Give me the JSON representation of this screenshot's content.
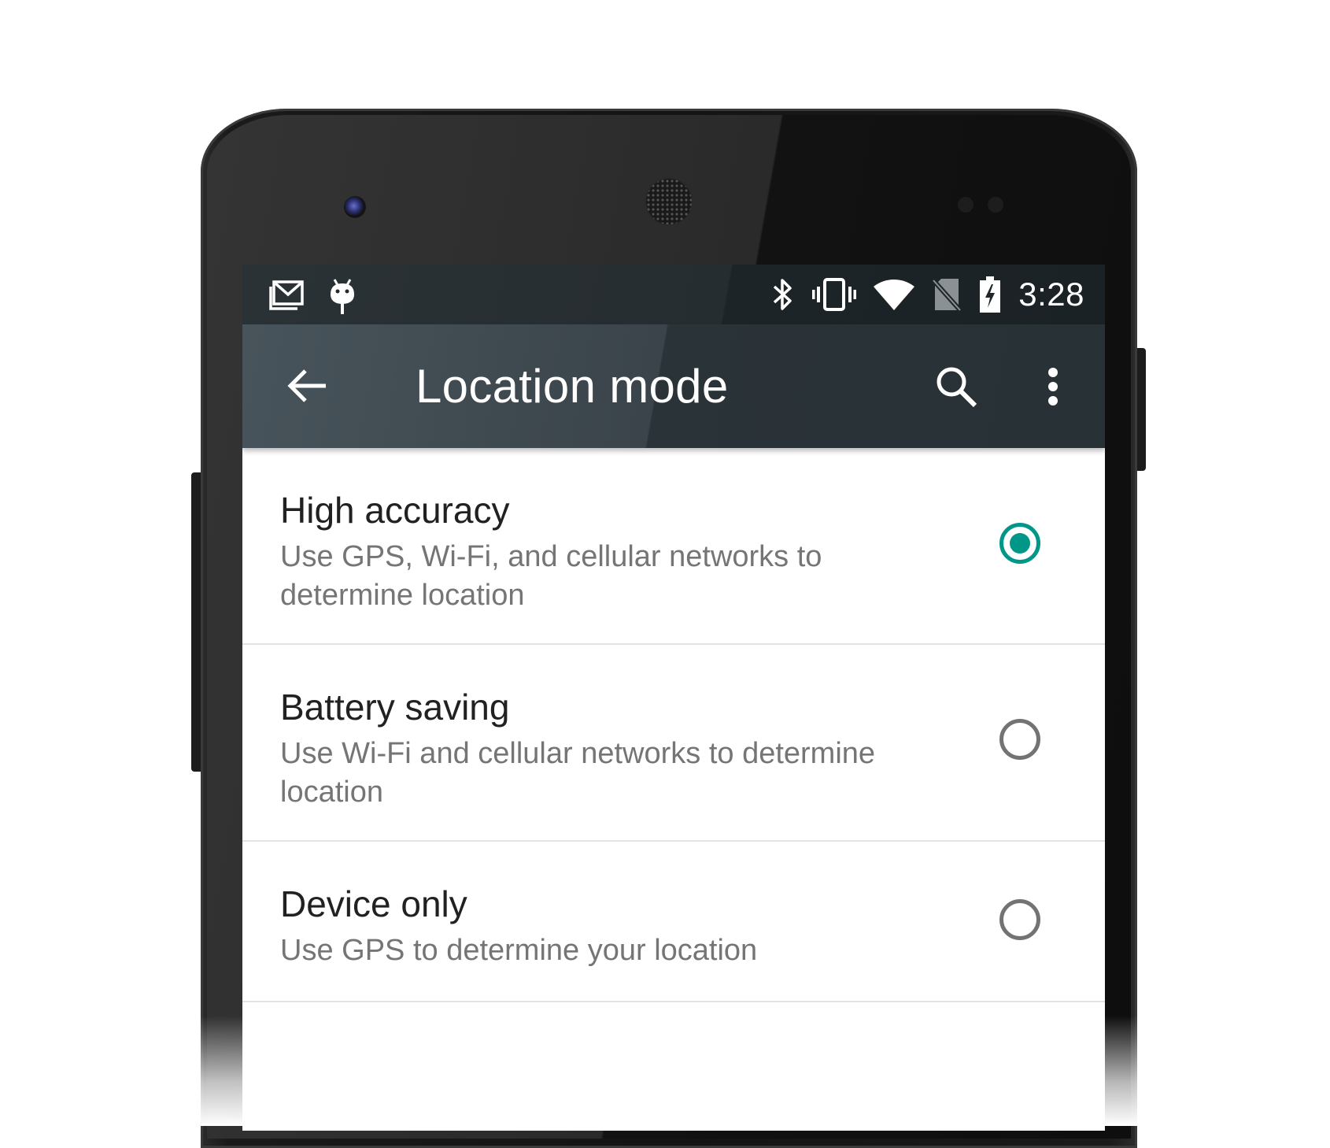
{
  "status_bar": {
    "time": "3:28",
    "icons_left": [
      "gmail-icon",
      "android-debug-icon"
    ],
    "icons_right": [
      "bluetooth-icon",
      "vibrate-icon",
      "wifi-icon",
      "no-sim-icon",
      "battery-charging-icon"
    ]
  },
  "app_bar": {
    "title": "Location mode",
    "back_icon": "arrow-back-icon",
    "search_icon": "search-icon",
    "overflow_icon": "more-vert-icon"
  },
  "options": [
    {
      "title": "High accuracy",
      "description": "Use GPS, Wi-Fi, and cellular networks to determine location",
      "selected": true
    },
    {
      "title": "Battery saving",
      "description": "Use Wi-Fi and cellular networks to determine location",
      "selected": false
    },
    {
      "title": "Device only",
      "description": "Use GPS to determine your location",
      "selected": false
    }
  ],
  "colors": {
    "accent": "#009688",
    "app_bar": "#37474f",
    "status_bar": "#263238",
    "primary_text": "#212121",
    "secondary_text": "#757575",
    "radio_unselected": "#737373"
  }
}
